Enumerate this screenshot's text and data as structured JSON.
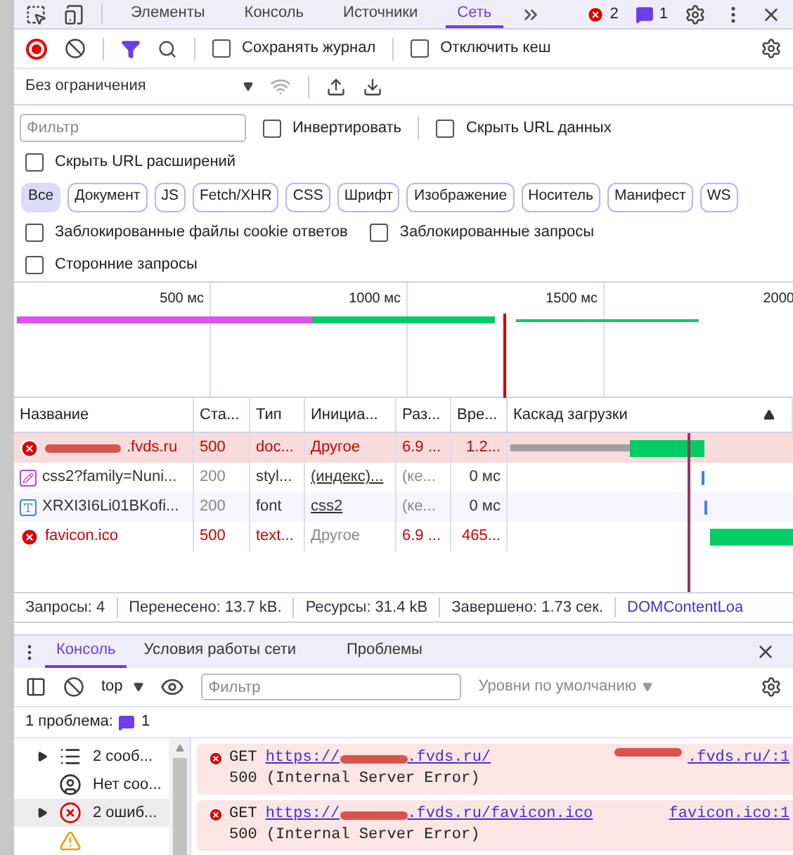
{
  "main_tabs": [
    {
      "label": "Элементы",
      "selected": false
    },
    {
      "label": "Консоль",
      "selected": false
    },
    {
      "label": "Источники",
      "selected": false
    },
    {
      "label": "Сеть",
      "selected": true
    }
  ],
  "badges": {
    "errors": "2",
    "issues": "1"
  },
  "toolbar": {
    "preserve_log": {
      "label": "Сохранять журнал",
      "checked": false
    },
    "disable_cache": {
      "label": "Отключить кеш",
      "checked": false
    },
    "throttling": "Без ограничения"
  },
  "filter": {
    "placeholder": "Фильтр",
    "invert": {
      "label": "Инвертировать",
      "checked": false
    },
    "hide_data_urls": {
      "label": "Скрыть URL данных",
      "checked": false
    },
    "hide_extension_urls": {
      "label": "Скрыть URL расширений",
      "checked": false
    }
  },
  "type_chips": [
    {
      "label": "Все",
      "selected": true
    },
    {
      "label": "Документ",
      "selected": false
    },
    {
      "label": "JS",
      "selected": false
    },
    {
      "label": "Fetch/XHR",
      "selected": false
    },
    {
      "label": "CSS",
      "selected": false
    },
    {
      "label": "Шрифт",
      "selected": false
    },
    {
      "label": "Изображение",
      "selected": false
    },
    {
      "label": "Носитель",
      "selected": false
    },
    {
      "label": "Манифест",
      "selected": false
    },
    {
      "label": "WS",
      "selected": false
    }
  ],
  "blocked_options": [
    {
      "label": "Заблокированные файлы cookie ответов",
      "checked": false
    },
    {
      "label": "Заблокированные запросы",
      "checked": false
    },
    {
      "label": "Сторонние запросы",
      "checked": false
    }
  ],
  "overview_ticks": [
    "500 мс",
    "1000 мс",
    "1500 мс",
    "2000"
  ],
  "table": {
    "columns": [
      "Название",
      "Ста...",
      "Тип",
      "Инициа...",
      "Раз...",
      "Вре...",
      "Каскад загрузки"
    ],
    "rows": [
      {
        "kind": "document",
        "name": ".fvds.ru",
        "redacted": true,
        "status": "500",
        "type": "doc...",
        "initiator": "Другое",
        "initiator_link": false,
        "initiator_dim": false,
        "size": "6.9 ...",
        "time": "1.2...",
        "error": true,
        "selected": true
      },
      {
        "kind": "stylesheet",
        "name": "css2?family=Nuni...",
        "redacted": false,
        "status": "200",
        "type": "styl...",
        "initiator": "(индекс)...",
        "initiator_link": true,
        "initiator_dim": false,
        "size": "(ке...",
        "time": "0 мс",
        "error": false,
        "selected": false
      },
      {
        "kind": "font",
        "name": "XRXI3I6Li01BKofi...",
        "redacted": false,
        "status": "200",
        "type": "font",
        "initiator": "css2",
        "initiator_link": true,
        "initiator_dim": false,
        "size": "(ке...",
        "time": "0 мс",
        "error": false,
        "selected": false
      },
      {
        "kind": "document",
        "name": "favicon.ico",
        "redacted": false,
        "status": "500",
        "type": "text...",
        "initiator": "Другое",
        "initiator_link": false,
        "initiator_dim": true,
        "size": "6.9 ...",
        "time": "465...",
        "error": true,
        "selected": false
      }
    ]
  },
  "status_bar": [
    "Запросы: 4",
    "Перенесено: 13.7 kB.",
    "Ресурсы: 31.4 kB",
    "Завершено: 1.73 сек.",
    "DOMContentLoa"
  ],
  "drawer_tabs": [
    {
      "label": "Консоль",
      "selected": true
    },
    {
      "label": "Условия работы сети",
      "selected": false
    },
    {
      "label": "Проблемы",
      "selected": false
    }
  ],
  "console_toolbar": {
    "context": "top",
    "placeholder": "Фильтр",
    "levels": "Уровни по умолчанию"
  },
  "issues_line": {
    "label": "1 проблема:",
    "count": "1"
  },
  "console_sidebar": [
    {
      "kind": "messages",
      "label": "2 сооб...",
      "expanded": false,
      "selected": false
    },
    {
      "kind": "user",
      "label": "Нет соо...",
      "selected": false
    },
    {
      "kind": "errors",
      "label": "2 ошиб...",
      "expanded": false,
      "selected": true
    },
    {
      "kind": "warnings",
      "selected": false
    }
  ],
  "messages": [
    {
      "method": "GET",
      "url_prefix": "https://",
      "url_suffix": ".fvds.ru/",
      "source": ".fvds.ru/:1",
      "source_redacted": true,
      "text": "500 (Internal Server Error)"
    },
    {
      "method": "GET",
      "url_prefix": "https://",
      "url_suffix": ".fvds.ru/favicon.ico",
      "source": "favicon.ico:1",
      "source_redacted": false,
      "text": "500 (Internal Server Error)"
    }
  ]
}
